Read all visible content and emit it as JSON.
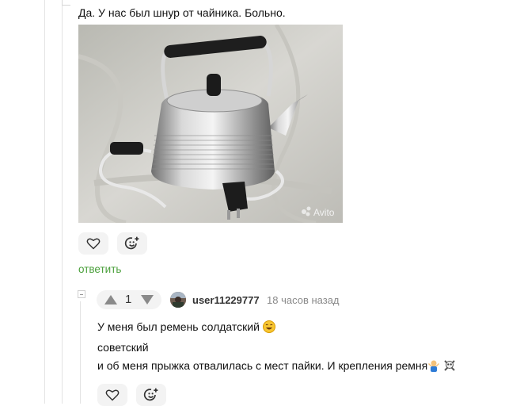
{
  "comment": {
    "text": "Да. У нас был шнур от чайника. Больно.",
    "image_watermark": "Avito",
    "reply_label": "ответить"
  },
  "reply": {
    "rating": "1",
    "username": "user11229777",
    "time": "18 часов назад",
    "lines": [
      "У меня был ремень солдатский",
      "советский",
      "и об меня прыжка отвалилась с мест пайки. И крепления ремня"
    ]
  },
  "icons": {
    "like": "heart-icon",
    "react": "add-emoji-icon",
    "vote_up": "triangle-up-icon",
    "vote_down": "triangle-down-icon",
    "collapse": "collapse-icon"
  },
  "colors": {
    "reply_link": "#4ba03c",
    "button_bg": "#f3f3f3",
    "muted": "#8a8a8a"
  }
}
